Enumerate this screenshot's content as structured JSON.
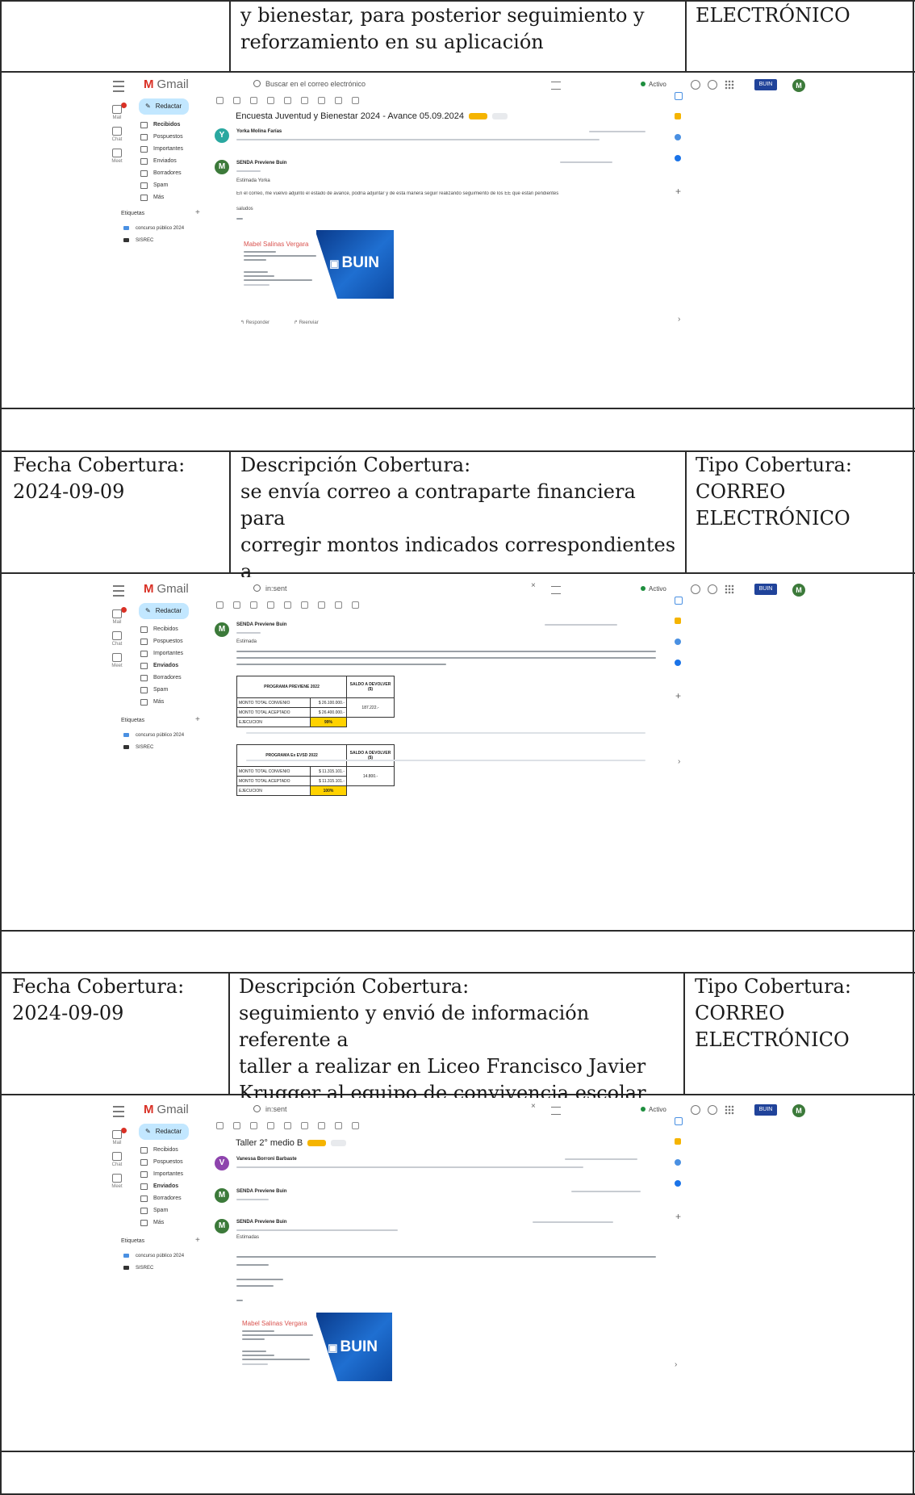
{
  "rows": [
    {
      "descripcion_lines": "y bienestar, para posterior seguimiento y\nreforzamiento en su aplicación",
      "tipo_value": "ELECTRÓNICO"
    },
    {
      "fecha_label": "Fecha Cobertura:",
      "fecha_value": "2024-09-09",
      "descripcion_label": "Descripción Cobertura:",
      "descripcion_text": "se envía correo a contraparte financiera para\ncorregir montos indicados correspondientes a\ncierres financieros y saldos a devolver.",
      "tipo_label": "Tipo Cobertura:",
      "tipo_value": "CORREO\nELECTRÓNICO"
    },
    {
      "fecha_label": "Fecha Cobertura:",
      "fecha_value": "2024-09-09",
      "descripcion_label": "Descripción Cobertura:",
      "descripcion_text": "seguimiento y envió de información referente a\ntaller a realizar en Liceo Francisco Javier\nKrugger al equipo de convivencia escolar",
      "tipo_label": "Tipo Cobertura:",
      "tipo_value": "CORREO\nELECTRÓNICO"
    }
  ],
  "gmail": {
    "logo": "Gmail",
    "compose": "Redactar",
    "active": "Activo",
    "rail": [
      "Mail",
      "Chat",
      "Meet"
    ],
    "nav": [
      "Recibidos",
      "Pospuestos",
      "Importantes",
      "Enviados",
      "Borradores",
      "Spam",
      "Más"
    ],
    "labels_title": "Etiquetas",
    "labels": [
      "concurso público 2024",
      "SISREC"
    ],
    "avatar_initial": "M",
    "buin_logo": "BUIN",
    "signature_name": "Mabel Salinas Vergara"
  },
  "screenshot1": {
    "search_placeholder": "Buscar en el correo electrónico",
    "subject": "Encuesta Juventud y Bienestar 2024 - Avance 05.09.2024",
    "sender1_initial": "Y",
    "sender1": "Yorka Molina Farías",
    "sender2": "SENDA Previene Buin",
    "greeting": "Estimada Yorka",
    "body": "En el correo, me vuelvo adjunto el estado de avance, podría adjuntar y de esta manera seguir realizando seguimiento de los EE que están pendientes",
    "closing": "saludos",
    "reply": "Responder",
    "forward": "Reenviar"
  },
  "screenshot2": {
    "search_value": "in:sent",
    "sender": "SENDA Previene Buin",
    "greeting": "Estimada",
    "table1": {
      "title": "PROGRAMA PREVIENE 2022",
      "saldo_header": "SALDO A DEVOLVER ($)",
      "row1_label": "MONTO TOTAL CONVENIO",
      "row1_value": "$ 26.100.000.-",
      "row2_label": "MONTO TOTAL ACEPTADO",
      "row2_value": "$ 26.400.000.-",
      "row3_label": "EJECUCION",
      "row3_value": "99%",
      "saldo": "187.222.-"
    },
    "table2": {
      "title": "PROGRAMA Ex EVSD 2022",
      "saldo_header": "SALDO A DEVOLVER ($)",
      "row1_label": "MONTO TOTAL CONVENIO",
      "row1_value": "$ 11.315.101.-",
      "row2_label": "MONTO TOTAL ACEPTADO",
      "row2_value": "$ 11.315.101.-",
      "row3_label": "EJECUCION",
      "row3_value": "100%",
      "saldo": "14.800.-"
    }
  },
  "screenshot3": {
    "search_value": "in:sent",
    "subject": "Taller 2° medio B",
    "sender1_initial": "V",
    "sender1": "Vanessa Borroni Barbaste",
    "sender2": "SENDA Previene Buin",
    "sender3": "SENDA Previene Buin",
    "greeting": "Estimadas"
  },
  "colors": {
    "gmail_red": "#d93025",
    "chip_yellow": "#f5b400",
    "buin_blue": "#1f6fd1",
    "avatar_green": "#3c7a3a"
  }
}
